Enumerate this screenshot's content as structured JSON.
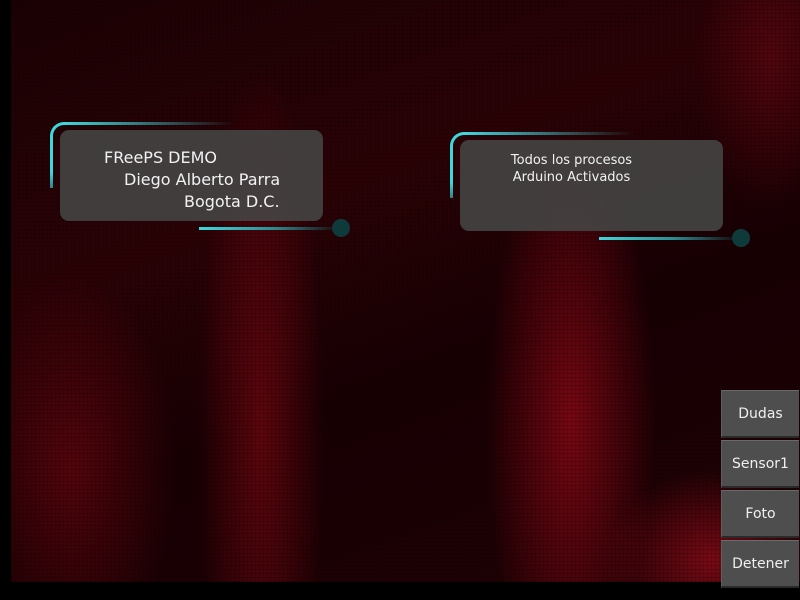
{
  "info_bubble": {
    "lines": [
      "FReePS DEMO",
      "Diego Alberto Parra",
      "Bogota D.C."
    ]
  },
  "status_bubble": {
    "lines": [
      "Todos los procesos",
      "Arduino Activados"
    ]
  },
  "buttons": {
    "dudas": "Dudas",
    "sensor1": "Sensor1",
    "foto": "Foto",
    "detener": "Detener"
  },
  "colors": {
    "accent": "#3fd6dc",
    "bubble_bg": "#464646",
    "button_bg": "#4e4e4e",
    "feed_red": "#aa0a19"
  }
}
